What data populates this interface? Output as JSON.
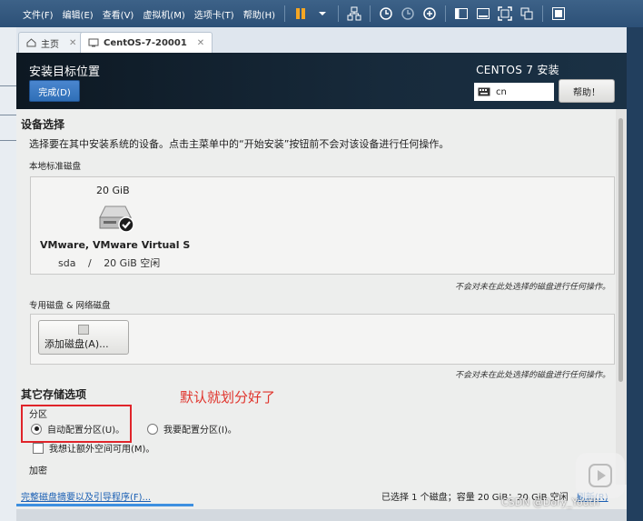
{
  "menubar": {
    "items": [
      "文件(F)",
      "编辑(E)",
      "查看(V)",
      "虚拟机(M)",
      "选项卡(T)",
      "帮助(H)"
    ]
  },
  "tabs": [
    {
      "label": "主页",
      "icon": "home-icon"
    },
    {
      "label": "CentOS-7-20001",
      "icon": "vm-icon"
    }
  ],
  "header": {
    "title": "安装目标位置",
    "done_label": "完成(D)",
    "os_name": "CENTOS 7 安装",
    "keyboard_layout": "cn",
    "help_label": "帮助！"
  },
  "device_selection": {
    "heading": "设备选择",
    "description": "选择要在其中安装系统的设备。点击主菜单中的“开始安装”按钮前不会对该设备进行任何操作。",
    "local_disks_label": "本地标准磁盘",
    "disk": {
      "size": "20 GiB",
      "name": "VMware, VMware Virtual S",
      "device": "sda",
      "separator": "/",
      "free": "20 GiB 空闲"
    },
    "note": "不会对未在此处选择的磁盘进行任何操作。"
  },
  "specialized": {
    "label": "专用磁盘 & 网络磁盘",
    "add_disk_label": "添加磁盘(A)...",
    "note": "不会对未在此处选择的磁盘进行任何操作。"
  },
  "other_options": {
    "heading": "其它存储选项",
    "partition_label": "分区",
    "auto_partition": "自动配置分区(U)。",
    "manual_partition": "我要配置分区(I)。",
    "extra_space": "我想让额外空间可用(M)。",
    "encryption_label": "加密"
  },
  "annotation": "默认就划分好了",
  "footer": {
    "summary_link": "完整磁盘摘要以及引导程序(F)...",
    "summary": "已选择 1 个磁盘；容量 20 GiB；20 GiB 空闲",
    "refresh": "刷新(R)"
  },
  "watermark": "CSDN @Dory_Youth"
}
